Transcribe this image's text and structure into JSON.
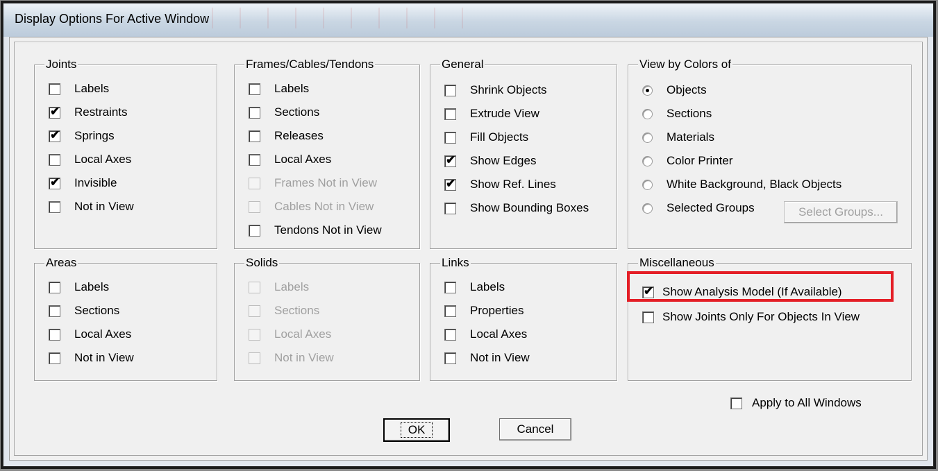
{
  "window": {
    "title": "Display Options For Active Window"
  },
  "groups": {
    "joints": {
      "label": "Joints",
      "items": [
        {
          "label": "Labels",
          "checked": false,
          "disabled": false
        },
        {
          "label": "Restraints",
          "checked": true,
          "disabled": false
        },
        {
          "label": "Springs",
          "checked": true,
          "disabled": false
        },
        {
          "label": "Local Axes",
          "checked": false,
          "disabled": false
        },
        {
          "label": "Invisible",
          "checked": true,
          "disabled": false
        },
        {
          "label": "Not in View",
          "checked": false,
          "disabled": false
        }
      ]
    },
    "frames": {
      "label": "Frames/Cables/Tendons",
      "items": [
        {
          "label": "Labels",
          "checked": false,
          "disabled": false
        },
        {
          "label": "Sections",
          "checked": false,
          "disabled": false
        },
        {
          "label": "Releases",
          "checked": false,
          "disabled": false
        },
        {
          "label": "Local Axes",
          "checked": false,
          "disabled": false
        },
        {
          "label": "Frames Not in View",
          "checked": false,
          "disabled": true
        },
        {
          "label": "Cables Not in View",
          "checked": false,
          "disabled": true
        },
        {
          "label": "Tendons Not in View",
          "checked": false,
          "disabled": false
        }
      ]
    },
    "general": {
      "label": "General",
      "items": [
        {
          "label": "Shrink Objects",
          "checked": false,
          "disabled": false
        },
        {
          "label": "Extrude View",
          "checked": false,
          "disabled": false
        },
        {
          "label": "Fill Objects",
          "checked": false,
          "disabled": false
        },
        {
          "label": "Show Edges",
          "checked": true,
          "disabled": false
        },
        {
          "label": "Show Ref. Lines",
          "checked": true,
          "disabled": false
        },
        {
          "label": "Show Bounding Boxes",
          "checked": false,
          "disabled": false
        }
      ]
    },
    "view_colors": {
      "label": "View by Colors of",
      "selected_index": 0,
      "options": [
        {
          "label": "Objects"
        },
        {
          "label": "Sections"
        },
        {
          "label": "Materials"
        },
        {
          "label": "Color Printer"
        },
        {
          "label": "White Background, Black Objects"
        },
        {
          "label": "Selected Groups"
        }
      ],
      "select_groups_button": "Select Groups..."
    },
    "areas": {
      "label": "Areas",
      "items": [
        {
          "label": "Labels",
          "checked": false,
          "disabled": false
        },
        {
          "label": "Sections",
          "checked": false,
          "disabled": false
        },
        {
          "label": "Local Axes",
          "checked": false,
          "disabled": false
        },
        {
          "label": "Not in View",
          "checked": false,
          "disabled": false
        }
      ]
    },
    "solids": {
      "label": "Solids",
      "items": [
        {
          "label": "Labels",
          "checked": false,
          "disabled": true
        },
        {
          "label": "Sections",
          "checked": false,
          "disabled": true
        },
        {
          "label": "Local Axes",
          "checked": false,
          "disabled": true
        },
        {
          "label": "Not in View",
          "checked": false,
          "disabled": true
        }
      ]
    },
    "links": {
      "label": "Links",
      "items": [
        {
          "label": "Labels",
          "checked": false,
          "disabled": false
        },
        {
          "label": "Properties",
          "checked": false,
          "disabled": false
        },
        {
          "label": "Local Axes",
          "checked": false,
          "disabled": false
        },
        {
          "label": "Not in View",
          "checked": false,
          "disabled": false
        }
      ]
    },
    "misc": {
      "label": "Miscellaneous",
      "items": [
        {
          "label": "Show Analysis Model  (If Available)",
          "checked": true,
          "disabled": false
        },
        {
          "label": "Show Joints Only For Objects In View",
          "checked": false,
          "disabled": false
        }
      ]
    }
  },
  "apply_all": {
    "label": "Apply to All Windows",
    "checked": false
  },
  "buttons": {
    "ok": "OK",
    "cancel": "Cancel"
  },
  "colors": {
    "highlight": "#e41e26",
    "face": "#f0f0f0"
  }
}
